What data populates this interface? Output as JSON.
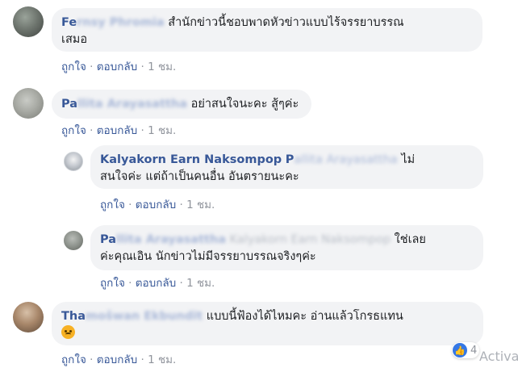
{
  "comments": [
    {
      "name_visible": "Fe",
      "name_blurred": "rnsy Phromia",
      "text_line1": "สำนักข่าวนี้ชอบพาดหัวข่าวแบบไร้จรรยาบรรณ",
      "text_line2": "เสมอ",
      "like": "ถูกใจ",
      "reply": "ตอบกลับ",
      "time": "1 ชม."
    },
    {
      "name_visible": "Pa",
      "name_blurred": "llita Arayasattha",
      "text_line1": "อย่าสนใจนะคะ สู้ๆค่ะ",
      "like": "ถูกใจ",
      "reply": "ตอบกลับ",
      "time": "1 ชม."
    },
    {
      "name_visible": "Kalyakorn Earn Naksompop",
      "name_extra": "P",
      "tag_blurred": "allita Arayasattha",
      "text_line1_end": "ไม่",
      "text_line2": "สนใจค่ะ แต่ถ้าเป็นคนอื่น อันตรายนะคะ",
      "like": "ถูกใจ",
      "reply": "ตอบกลับ",
      "time": "1 ชม."
    },
    {
      "name_visible": "Pa",
      "name_blurred": "llita Arayasattha",
      "tag_blurred": "Kalyakorn Earn Naksompop",
      "text_line1_end": "ใช่เลย",
      "text_line2": "ค่ะคุณเอิน นักข่าวไม่มีจรรยาบรรณจริงๆค่ะ",
      "like": "ถูกใจ",
      "reply": "ตอบกลับ",
      "time": "1 ชม."
    },
    {
      "name_visible": "Tha",
      "name_blurred": "mošwan Ekbundit",
      "text_line1": "แบบนี้ฟ้องได้ไหมคะ อ่านแล้วโกรธแทน",
      "like": "ถูกใจ",
      "reply": "ตอบกลับ",
      "time": "1 ชม.",
      "emoji": "angry-face-emoji",
      "reaction_count": "4"
    }
  ],
  "separator": "·",
  "reaction_icon": "thumbs-up-icon",
  "watermark": "Activa"
}
